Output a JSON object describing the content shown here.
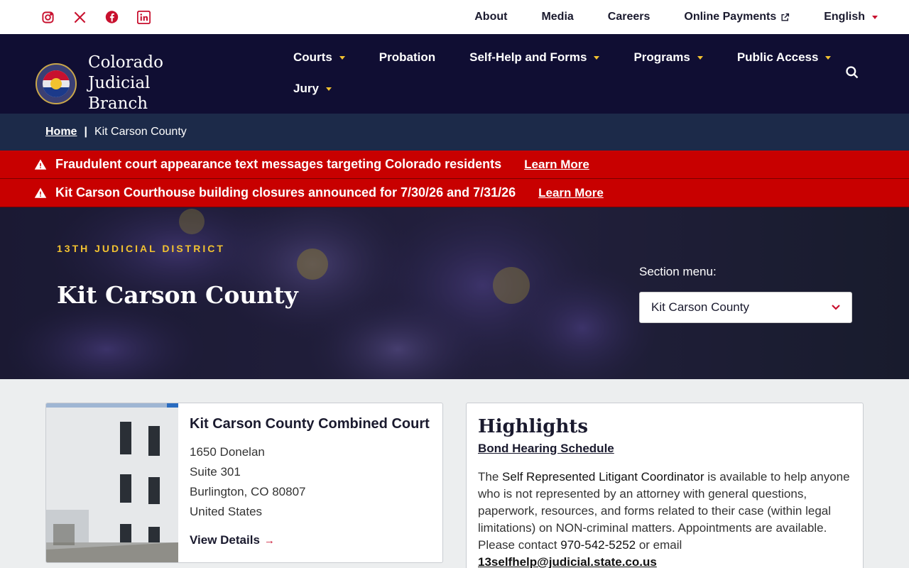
{
  "utility": {
    "social": [
      "instagram-icon",
      "x-icon",
      "facebook-icon",
      "linkedin-icon"
    ],
    "links": [
      "About",
      "Media",
      "Careers",
      "Online Payments",
      "English"
    ]
  },
  "brand": {
    "name_line1": "Colorado Judicial",
    "name_line2": "Branch"
  },
  "nav": {
    "courts": "Courts",
    "probation": "Probation",
    "self_help": "Self-Help and Forms",
    "programs": "Programs",
    "public_access": "Public Access",
    "jury": "Jury"
  },
  "breadcrumb": {
    "home": "Home",
    "current": "Kit Carson County"
  },
  "alerts": [
    {
      "text": "Fraudulent court appearance text messages targeting Colorado residents",
      "link": "Learn More"
    },
    {
      "text": "Kit Carson Courthouse building closures announced for 7/30/26 and 7/31/26",
      "link": "Learn More"
    }
  ],
  "hero": {
    "eyebrow": "13TH JUDICIAL DISTRICT",
    "title": "Kit Carson County",
    "section_menu_label": "Section menu:",
    "section_menu_value": "Kit Carson County"
  },
  "court": {
    "name": "Kit Carson County Combined Court",
    "address1": "1650 Donelan",
    "address2": "Suite 301",
    "city": "Burlington, CO 80807",
    "country": "United States",
    "view": "View Details"
  },
  "highlights": {
    "title": "Highlights",
    "bond_link": "Bond Hearing Schedule",
    "p_before": "The ",
    "coordinator": "Self Represented Litigant Coordinator",
    "p_mid": " is available to help anyone who is not represented by an attorney with  general questions, paperwork, resources, and forms related to their case (within legal limitations) on NON-criminal matters.  Appointments are available. Please contact ",
    "phone": "970-542-5252",
    "p_end": " or email ",
    "email": "13selfhelp@judicial.state.co.us"
  },
  "colors": {
    "navy": "#100e33",
    "crumb_bg": "#1c2a49",
    "alert_red": "#c80000",
    "accent_gold": "#f2c230",
    "accent_red": "#c8102e"
  }
}
